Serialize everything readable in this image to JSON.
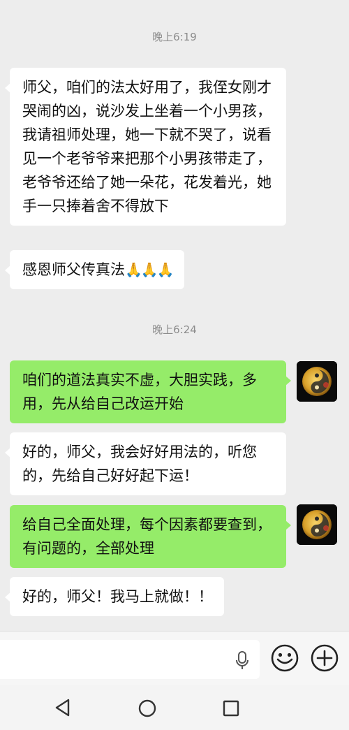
{
  "timestamps": [
    "晚上6:19",
    "晚上6:24"
  ],
  "messages": [
    {
      "side": "left",
      "text": "师父，咱们的法太好用了，我侄女刚才哭闹的凶，说沙发上坐着一个小男孩，我请祖师处理，她一下就不哭了，说看见一个老爷爷来把那个小男孩带走了，老爷爷还给了她一朵花，花发着光，她手一只捧着舍不得放下"
    },
    {
      "side": "left",
      "text": "感恩师父传真法",
      "emoji": "🙏🙏🙏"
    },
    {
      "side": "right",
      "text": "咱们的道法真实不虚，大胆实践，多用，先从给自己改运开始",
      "avatar": "yin-yang-moon-avatar"
    },
    {
      "side": "left",
      "text": "好的，师父，我会好好用法的，听您的，先给自己好好起下运！"
    },
    {
      "side": "right",
      "text": "给自己全面处理，每个因素都要查到，有问题的，全部处理",
      "avatar": "yin-yang-moon-avatar"
    },
    {
      "side": "left",
      "text": "好的，师父！我马上就做！！"
    }
  ],
  "input": {
    "value": "",
    "icons": [
      "microphone-icon",
      "emoji-smile-icon",
      "plus-circle-icon"
    ]
  },
  "navbar": {
    "icons": [
      "back-triangle-icon",
      "home-circle-icon",
      "recent-square-icon"
    ]
  },
  "colors": {
    "background": "#ededed",
    "bubble_left": "#ffffff",
    "bubble_right": "#95ec69",
    "timestamp": "#8c8c8c"
  }
}
